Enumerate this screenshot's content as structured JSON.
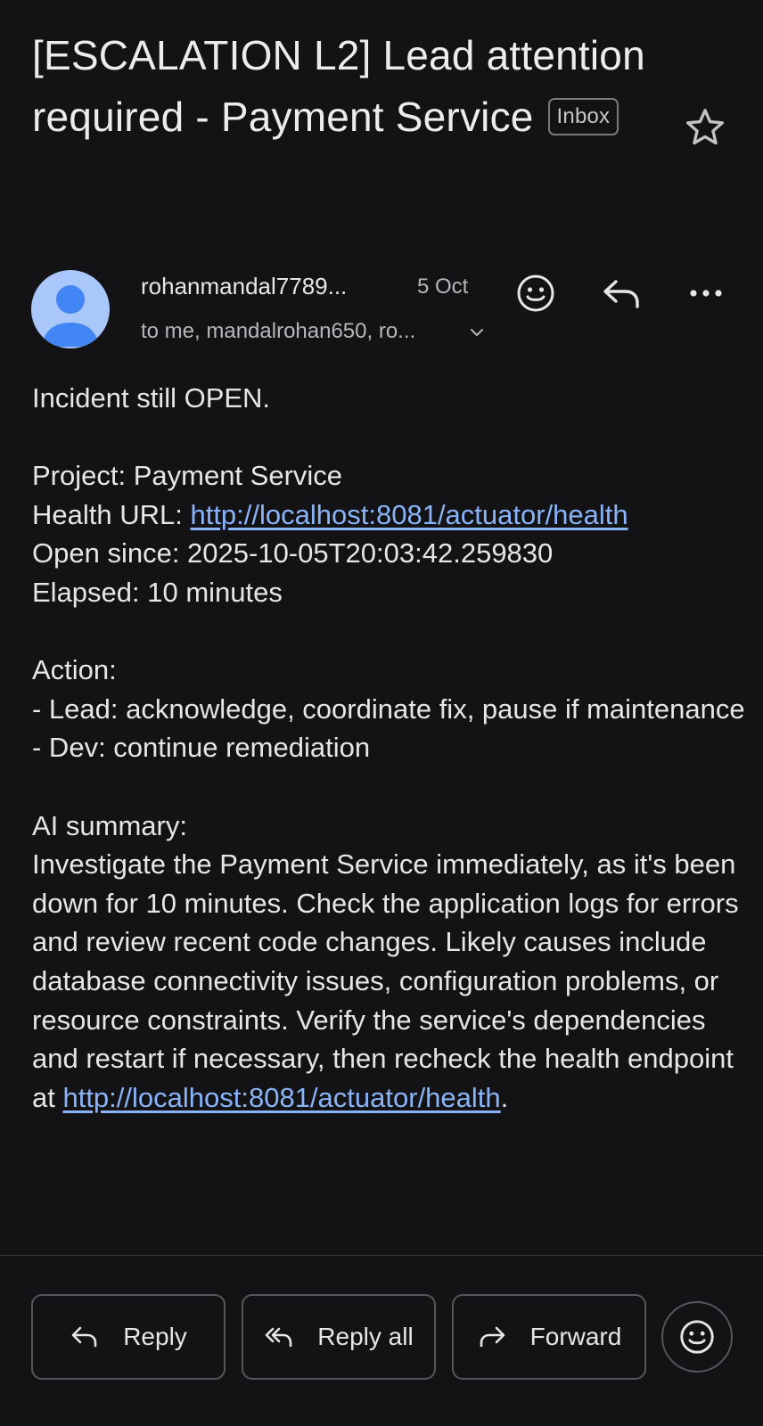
{
  "email": {
    "subject": "[ESCALATION L2] Lead attention required - Payment Service",
    "label": "Inbox",
    "sender": "rohanmandal7789...",
    "date": "5 Oct",
    "recipients": "to me, mandalrohan650, ro...",
    "body": {
      "line1": "Incident still OPEN.",
      "project": "Project: Payment Service",
      "health_label": "Health URL: ",
      "health_url": "http://localhost:8081/actuator/health",
      "open_since": "Open since: 2025-10-05T20:03:42.259830",
      "elapsed": "Elapsed: 10 minutes",
      "action_heading": "Action:",
      "action_lead": "- Lead: acknowledge, coordinate fix, pause if maintenance",
      "action_dev": "- Dev: continue remediation",
      "ai_heading": "AI summary:",
      "ai_summary": "Investigate the Payment Service immediately, as it's been down for 10 minutes. Check the application logs for errors and review recent code changes. Likely causes include database connectivity issues, configuration problems, or resource constraints. Verify the service's dependencies and restart if necessary, then recheck the health endpoint at ",
      "ai_url": "http://localhost:8081/actuator/health",
      "ai_end": "."
    }
  },
  "actions": {
    "reply": "Reply",
    "reply_all": "Reply all",
    "forward": "Forward"
  },
  "icons": {
    "star": "star-icon",
    "avatar": "person-icon",
    "emoji": "smiley-icon",
    "reply": "reply-icon",
    "reply_all": "reply-all-icon",
    "forward": "forward-icon",
    "more": "more-horizontal-icon",
    "chevron": "chevron-down-icon"
  },
  "colors": {
    "background": "#131316",
    "link": "#8ab4f8",
    "avatar_bg": "#a9c7fa",
    "avatar_fg": "#4285f4"
  }
}
